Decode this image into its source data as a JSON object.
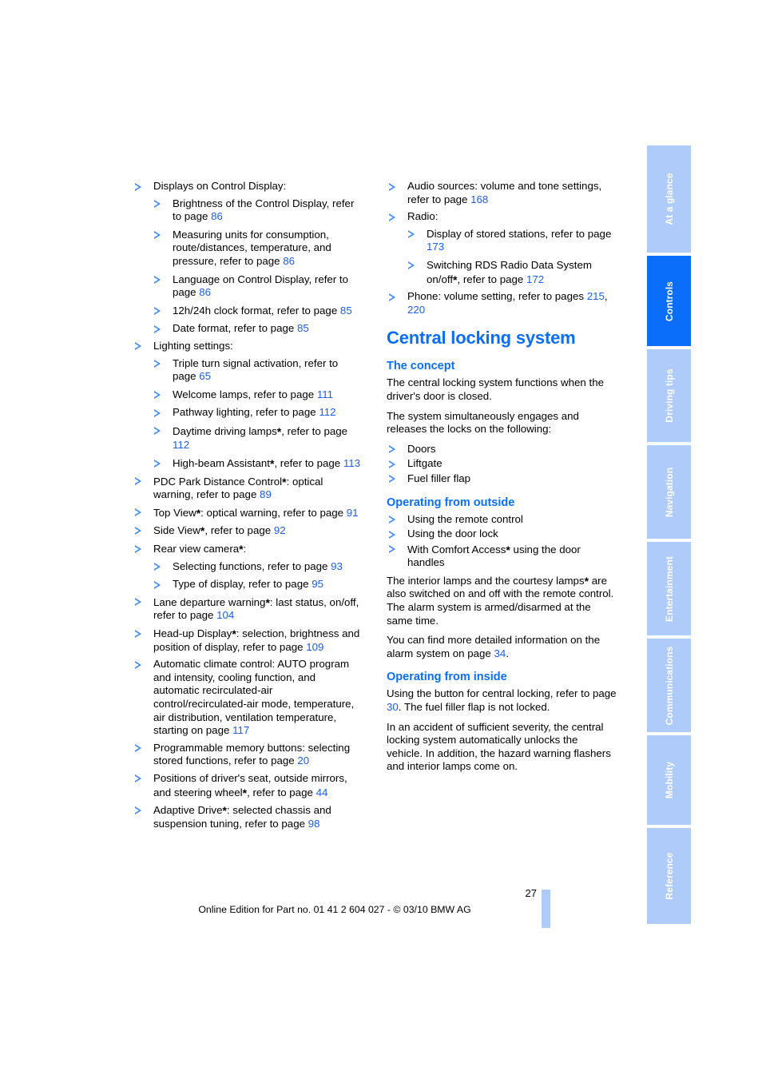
{
  "document": {
    "page_number": "27",
    "footer_text": "Online Edition for Part no. 01 41 2 604 027 - © 03/10 BMW AG",
    "accent_color": "#0a6efb",
    "tab_color": "#aecbfa",
    "page_link_color": "#1a5df0"
  },
  "tabs": [
    {
      "label": "At a glance",
      "active": false
    },
    {
      "label": "Controls",
      "active": true
    },
    {
      "label": "Driving tips",
      "active": false
    },
    {
      "label": "Navigation",
      "active": false
    },
    {
      "label": "Entertainment",
      "active": false
    },
    {
      "label": "Communications",
      "active": false
    },
    {
      "label": "Mobility",
      "active": false
    },
    {
      "label": "Reference",
      "active": false
    }
  ],
  "left_column": {
    "items": [
      {
        "text": "Displays on Control Display:"
      },
      {
        "text": "Brightness of the Control Display, refer to page 86"
      },
      {
        "text": "Measuring units for consumption, route/distances, temperature, and pressure, refer to page 86"
      },
      {
        "text": "Language on Control Display, refer to page 86"
      },
      {
        "text": "12h/24h clock format, refer to page 85"
      },
      {
        "text": "Date format, refer to page 85"
      },
      {
        "text": "Lighting settings:"
      },
      {
        "text": "Triple turn signal activation, refer to page 65"
      },
      {
        "text": "Welcome lamps, refer to page 111"
      },
      {
        "text": "Pathway lighting, refer to page 112"
      },
      {
        "text": "Daytime driving lamps*, refer to page 112"
      },
      {
        "text": "High-beam Assistant*, refer to page 113"
      },
      {
        "text": "PDC Park Distance Control*: optical warning, refer to page 89"
      },
      {
        "text": "Top View*: optical warning, refer to page 91"
      },
      {
        "text": "Side View*, refer to page 92"
      },
      {
        "text": "Rear view camera*:"
      },
      {
        "text": "Selecting functions, refer to page 93"
      },
      {
        "text": "Type of display, refer to page 95"
      },
      {
        "text": "Lane departure warning*: last status, on/off, refer to page 104"
      },
      {
        "text": "Head-up Display*: selection, brightness and position of display, refer to page 109"
      },
      {
        "text": "Automatic climate control: AUTO program and intensity, cooling function, and automatic recirculated-air control/recirculated-air mode, temperature, air distribution, ventilation temperature, starting on page 117"
      },
      {
        "text": "Programmable memory buttons: selecting stored functions, refer to page 20"
      },
      {
        "text": "Positions of driver's seat, outside mirrors, and steering wheel*, refer to page 44"
      },
      {
        "text": "Adaptive Drive*: selected chassis and suspension tuning, refer to page 98"
      }
    ]
  },
  "right_column": {
    "intro_items": [
      {
        "text": "Audio sources: volume and tone settings, refer to page 168"
      },
      {
        "text": "Radio:"
      },
      {
        "text": "Display of stored stations, refer to page 173"
      },
      {
        "text": "Switching RDS Radio Data System on/off*, refer to page 172"
      },
      {
        "text": "Phone: volume setting, refer to pages 215, 220"
      }
    ],
    "section_title": "Central locking system",
    "concept": {
      "heading": "The concept",
      "para1": "The central locking system functions when the driver's door is closed.",
      "para2": "The system simultaneously engages and releases the locks on the following:",
      "items": [
        "Doors",
        "Liftgate",
        "Fuel filler flap"
      ]
    },
    "outside": {
      "heading": "Operating from outside",
      "items": [
        "Using the remote control",
        "Using the door lock",
        "With Comfort Access* using the door handles"
      ],
      "para1": "The interior lamps and the courtesy lamps* are also switched on and off with the remote control. The alarm system is armed/disarmed at the same time.",
      "para2": "You can find more detailed information on the alarm system on page 34."
    },
    "inside": {
      "heading": "Operating from inside",
      "para1": "Using the button for central locking, refer to page 30. The fuel filler flap is not locked.",
      "para2": "In an accident of sufficient severity, the central locking system automatically unlocks the vehicle. In addition, the hazard warning flashers and interior lamps come on."
    }
  }
}
